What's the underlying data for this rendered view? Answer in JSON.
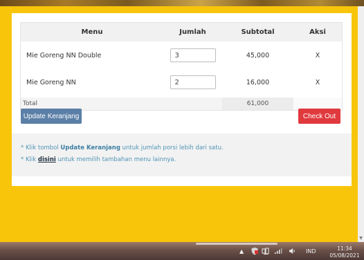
{
  "table": {
    "headers": {
      "menu": "Menu",
      "qty": "Jumlah",
      "subtotal": "Subtotal",
      "action": "Aksi"
    },
    "rows": [
      {
        "menu": "Mie Goreng NN Double",
        "qty": "3",
        "subtotal": "45,000",
        "action": "X"
      },
      {
        "menu": "Mie Goreng NN",
        "qty": "2",
        "subtotal": "16,000",
        "action": "X"
      }
    ],
    "total": {
      "label": "Total",
      "value": "61,000"
    }
  },
  "buttons": {
    "update": "Update Keranjang",
    "checkout": "Check Out"
  },
  "info": {
    "line1": {
      "prefix": "* Klik tombol ",
      "bold": "Update Keranjang",
      "suffix": " untuk jumlah porsi lebih dari satu."
    },
    "line2": {
      "prefix": "* Klik ",
      "link": "disini",
      "suffix": " untuk memilih tambahan menu lainnya."
    }
  },
  "taskbar": {
    "tray_arrow": "▲",
    "language": "IND",
    "time": "11:34",
    "date": "05/08/2021"
  },
  "colors": {
    "page_background": "#f8c50a",
    "update_button": "#5b7fa6",
    "checkout_button": "#e0393e",
    "info_text": "#4f93b5"
  },
  "icons": {
    "tray": [
      "shield-icon",
      "network-icon",
      "signal-icon",
      "volume-icon"
    ],
    "scroll": "scroll-down-arrow-icon"
  }
}
